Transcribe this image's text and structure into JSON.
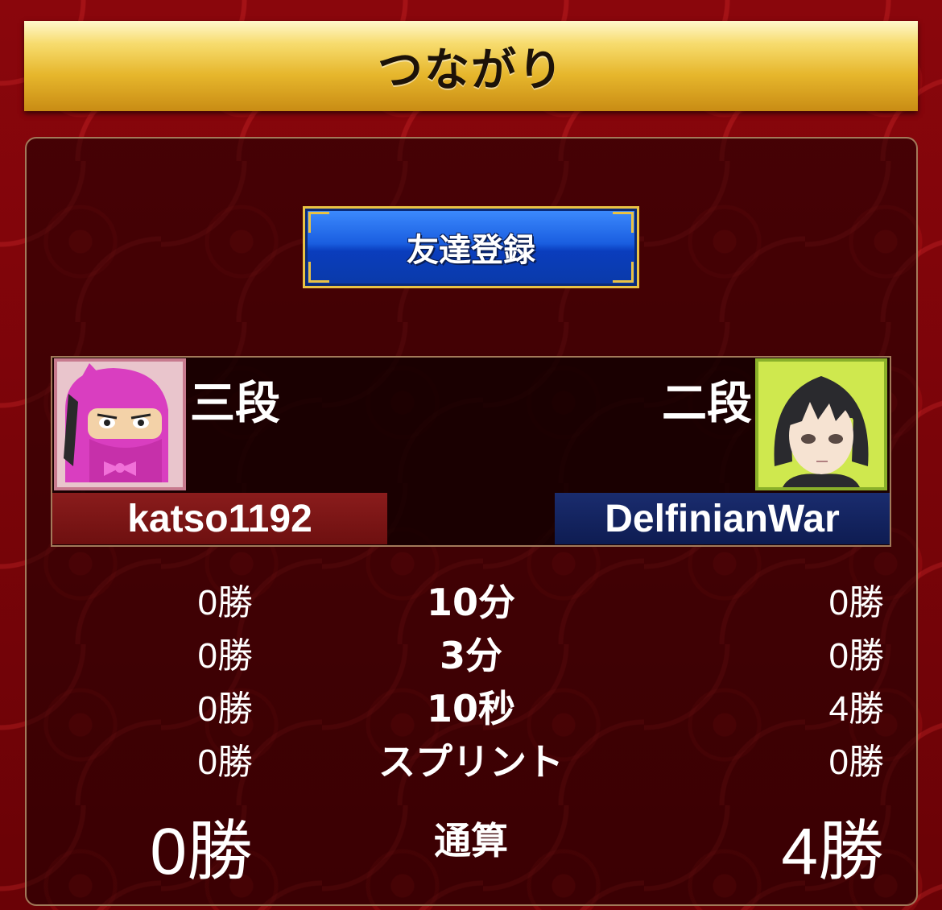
{
  "header": {
    "title": "つながり"
  },
  "friend_button": {
    "label": "友達登録"
  },
  "players": {
    "left": {
      "rank": "三段",
      "name": "katso1192"
    },
    "right": {
      "rank": "二段",
      "name": "DelfinianWar"
    }
  },
  "records": [
    {
      "mode": "10分",
      "left": "0勝",
      "right": "0勝"
    },
    {
      "mode": "3分",
      "left": "0勝",
      "right": "0勝"
    },
    {
      "mode": "10秒",
      "left": "0勝",
      "right": "4勝"
    },
    {
      "mode": "スプリント",
      "left": "0勝",
      "right": "0勝"
    }
  ],
  "total": {
    "label": "通算",
    "left": "0勝",
    "right": "4勝"
  }
}
